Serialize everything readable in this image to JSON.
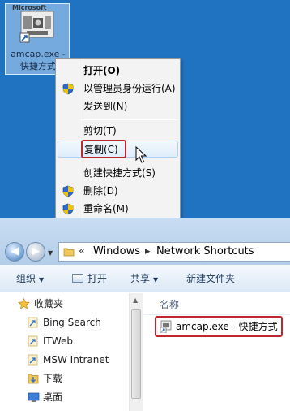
{
  "desktop": {
    "icon_caption": "Microsoft",
    "icon_label_line1": "amcap.exe -",
    "icon_label_line2": "快捷方式"
  },
  "context_menu": {
    "items": [
      {
        "label": "打开(O)",
        "bold": true,
        "shield": false
      },
      {
        "label": "以管理员身份运行(A)",
        "bold": false,
        "shield": true
      },
      {
        "label": "发送到(N)",
        "bold": false,
        "shield": false
      },
      {
        "label": "剪切(T)",
        "bold": false,
        "shield": false
      },
      {
        "label": "复制(C)",
        "bold": false,
        "shield": false,
        "highlighted": true
      },
      {
        "label": "创建快捷方式(S)",
        "bold": false,
        "shield": false
      },
      {
        "label": "删除(D)",
        "bold": false,
        "shield": true
      },
      {
        "label": "重命名(M)",
        "bold": false,
        "shield": true
      }
    ]
  },
  "explorer": {
    "nav_back_glyph": "◀",
    "nav_fwd_glyph": "▶",
    "address": {
      "prefix": "«",
      "crumbs": [
        "Windows",
        "Network Shortcuts"
      ],
      "separator": "▸"
    },
    "commands": {
      "organize": "组织",
      "open": "打开",
      "share": "共享",
      "new_folder": "新建文件夹"
    },
    "nav_pane": {
      "favorites": "收藏夹",
      "items": [
        "Bing Search",
        "ITWeb",
        "MSW Intranet",
        "下载",
        "桌面"
      ]
    },
    "content": {
      "column_name": "名称",
      "file": "amcap.exe - 快捷方式"
    }
  },
  "colors": {
    "desktop": "#1f73c1",
    "highlight_box": "#c0272d",
    "menu_bg": "#f3f3f3",
    "cmdbar_text": "#1e395b"
  }
}
